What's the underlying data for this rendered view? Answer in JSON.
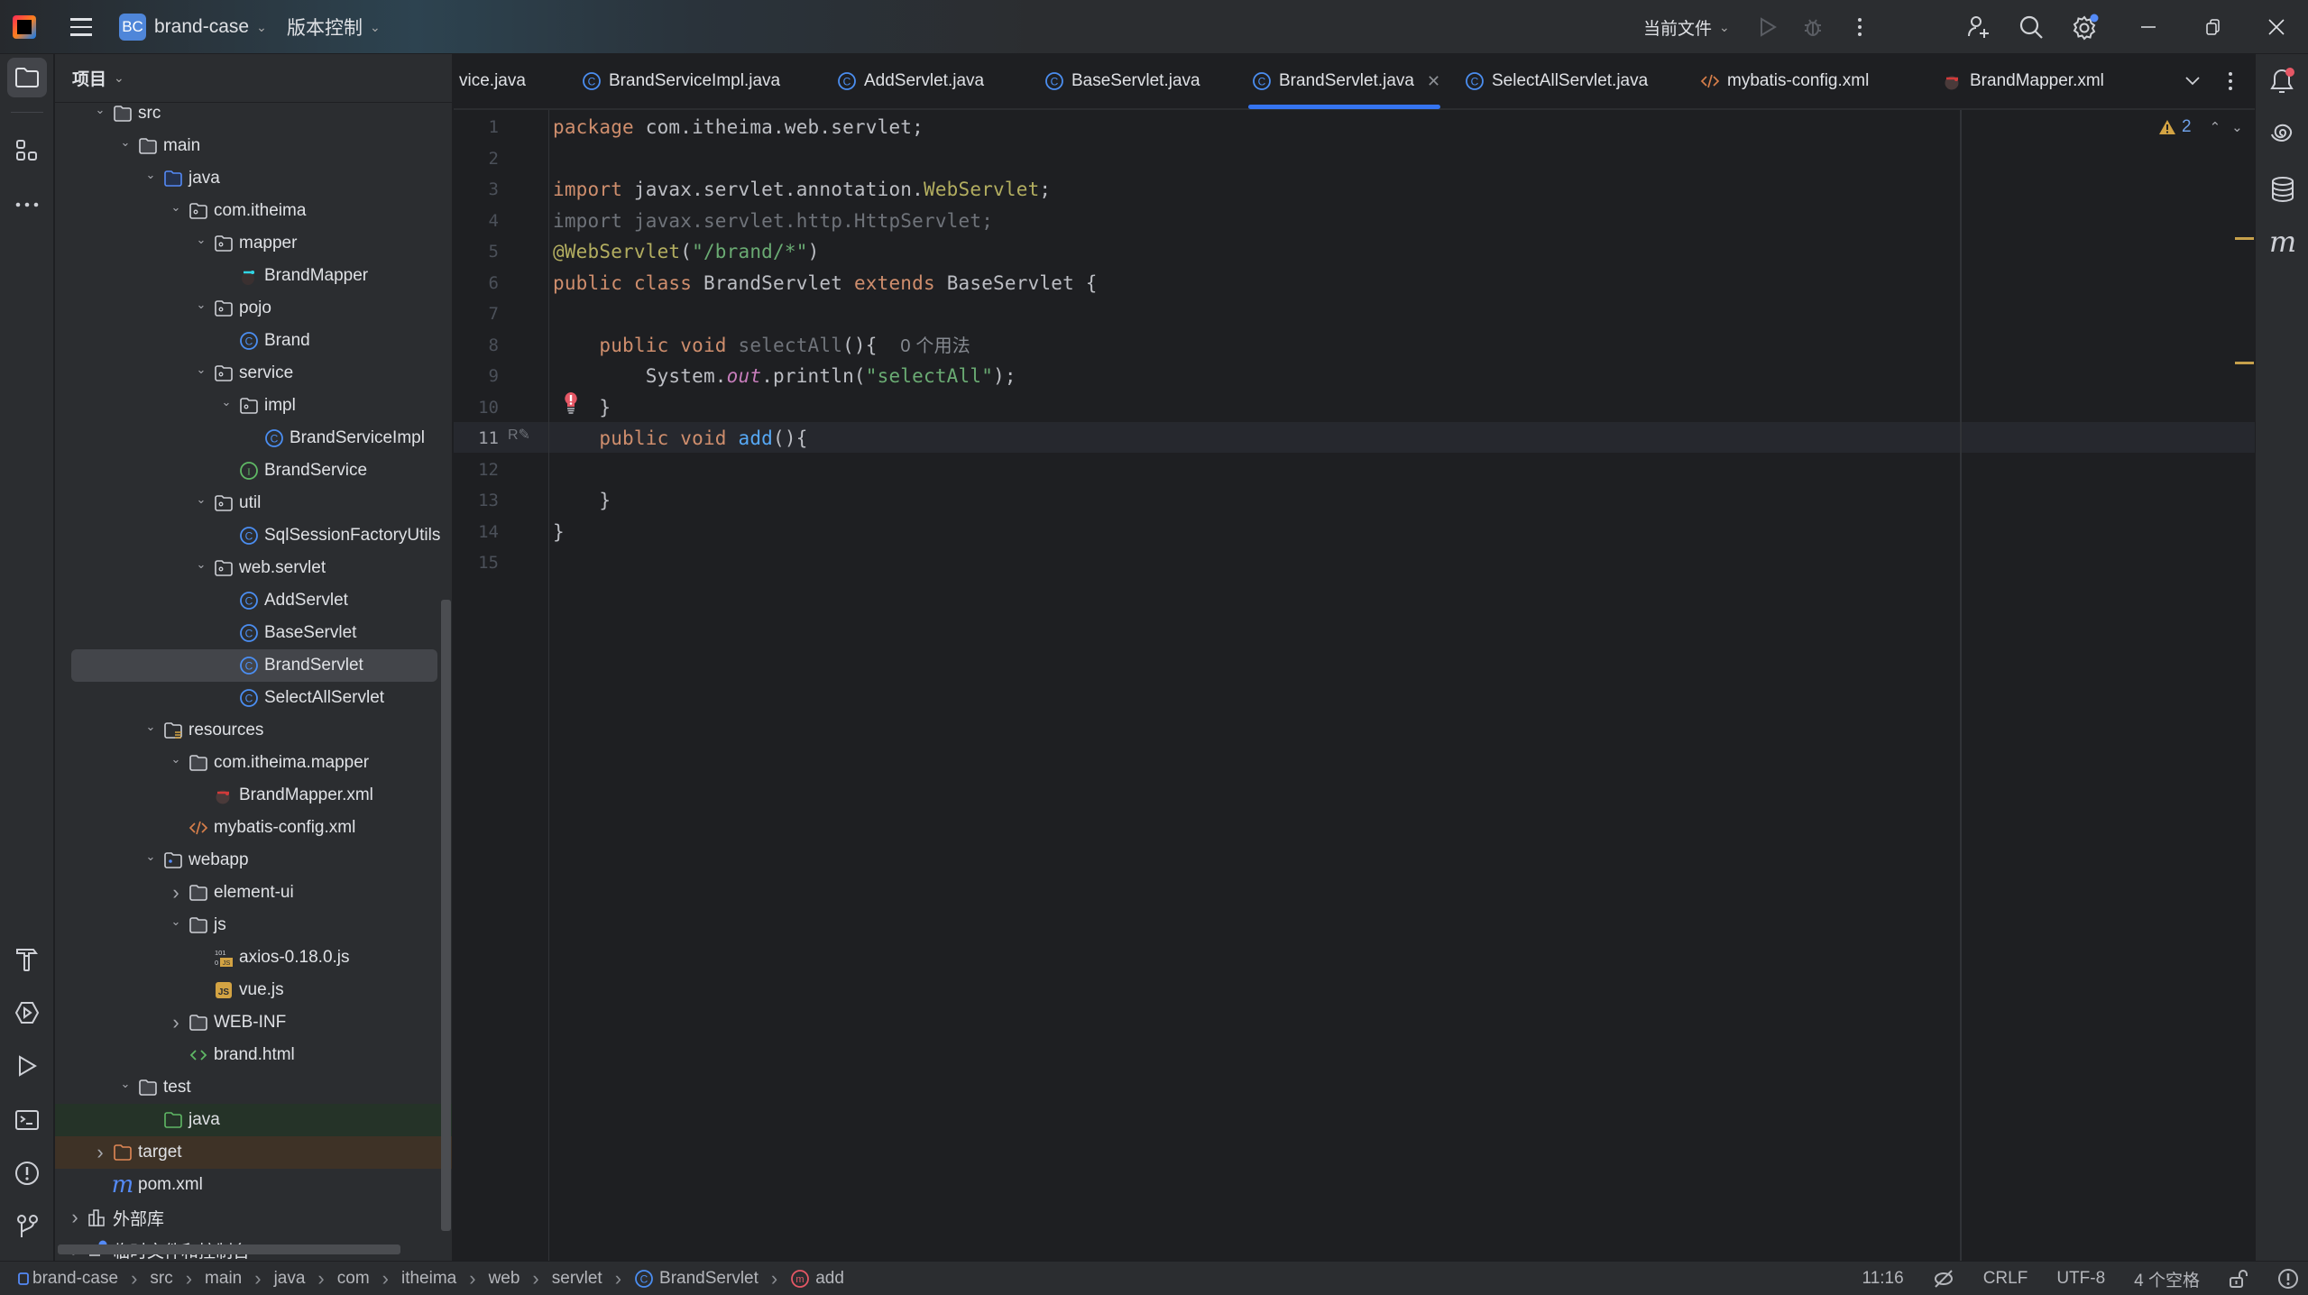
{
  "titlebar": {
    "project_badge": "BC",
    "project_name": "brand-case",
    "vcs_label": "版本控制",
    "run_config": "当前文件"
  },
  "project_panel": {
    "title": "项目",
    "tree": [
      {
        "label": "src",
        "depth": 2,
        "expanded": true,
        "icon": "folder-icon"
      },
      {
        "label": "main",
        "depth": 3,
        "expanded": true,
        "icon": "folder-icon"
      },
      {
        "label": "java",
        "depth": 4,
        "expanded": true,
        "icon": "source-folder-icon"
      },
      {
        "label": "com.itheima",
        "depth": 5,
        "expanded": true,
        "icon": "package-icon"
      },
      {
        "label": "mapper",
        "depth": 6,
        "expanded": true,
        "icon": "package-icon"
      },
      {
        "label": "BrandMapper",
        "depth": 7,
        "icon": "mybatis-mapper-icon"
      },
      {
        "label": "pojo",
        "depth": 6,
        "expanded": true,
        "icon": "package-icon"
      },
      {
        "label": "Brand",
        "depth": 7,
        "icon": "class-icon"
      },
      {
        "label": "service",
        "depth": 6,
        "expanded": true,
        "icon": "package-icon"
      },
      {
        "label": "impl",
        "depth": 7,
        "expanded": true,
        "icon": "package-icon"
      },
      {
        "label": "BrandServiceImpl",
        "depth": 8,
        "icon": "class-icon"
      },
      {
        "label": "BrandService",
        "depth": 7,
        "icon": "interface-icon"
      },
      {
        "label": "util",
        "depth": 6,
        "expanded": true,
        "icon": "package-icon"
      },
      {
        "label": "SqlSessionFactoryUtils",
        "depth": 7,
        "icon": "class-icon"
      },
      {
        "label": "web.servlet",
        "depth": 6,
        "expanded": true,
        "icon": "package-icon"
      },
      {
        "label": "AddServlet",
        "depth": 7,
        "icon": "class-icon"
      },
      {
        "label": "BaseServlet",
        "depth": 7,
        "icon": "class-icon"
      },
      {
        "label": "BrandServlet",
        "depth": 7,
        "icon": "class-icon",
        "selected": true
      },
      {
        "label": "SelectAllServlet",
        "depth": 7,
        "icon": "class-icon"
      },
      {
        "label": "resources",
        "depth": 4,
        "expanded": true,
        "icon": "resources-folder-icon"
      },
      {
        "label": "com.itheima.mapper",
        "depth": 5,
        "expanded": true,
        "icon": "folder-icon"
      },
      {
        "label": "BrandMapper.xml",
        "depth": 6,
        "icon": "mybatis-xml-icon"
      },
      {
        "label": "mybatis-config.xml",
        "depth": 5,
        "icon": "xml-icon"
      },
      {
        "label": "webapp",
        "depth": 4,
        "expanded": true,
        "icon": "web-folder-icon"
      },
      {
        "label": "element-ui",
        "depth": 5,
        "expanded": false,
        "icon": "folder-icon"
      },
      {
        "label": "js",
        "depth": 5,
        "expanded": true,
        "icon": "folder-icon"
      },
      {
        "label": "axios-0.18.0.js",
        "depth": 6,
        "icon": "minified-js-icon"
      },
      {
        "label": "vue.js",
        "depth": 6,
        "icon": "js-icon"
      },
      {
        "label": "WEB-INF",
        "depth": 5,
        "expanded": false,
        "icon": "folder-icon"
      },
      {
        "label": "brand.html",
        "depth": 5,
        "icon": "html-icon"
      },
      {
        "label": "test",
        "depth": 3,
        "expanded": true,
        "icon": "folder-icon"
      },
      {
        "label": "java",
        "depth": 4,
        "icon": "test-folder-icon",
        "highlight": "test"
      },
      {
        "label": "target",
        "depth": 2,
        "expanded": false,
        "icon": "excluded-folder-icon",
        "highlight": "excluded"
      },
      {
        "label": "pom.xml",
        "depth": 2,
        "icon": "maven-icon"
      },
      {
        "label": "外部库",
        "depth": 1,
        "expanded": false,
        "icon": "library-icon"
      },
      {
        "label": "临时文件和控制台",
        "depth": 1,
        "expanded": false,
        "icon": "scratches-icon"
      }
    ]
  },
  "tabs": [
    {
      "label": "vice.java",
      "icon": "none"
    },
    {
      "label": "BrandServiceImpl.java",
      "icon": "class-icon"
    },
    {
      "label": "AddServlet.java",
      "icon": "class-icon"
    },
    {
      "label": "BaseServlet.java",
      "icon": "class-icon"
    },
    {
      "label": "BrandServlet.java",
      "icon": "class-icon",
      "active": true
    },
    {
      "label": "SelectAllServlet.java",
      "icon": "class-icon"
    },
    {
      "label": "mybatis-config.xml",
      "icon": "xml-icon"
    },
    {
      "label": "BrandMapper.xml",
      "icon": "mybatis-xml-icon"
    }
  ],
  "editor": {
    "warning_count": "2",
    "current_line": 11,
    "lines": [
      {
        "n": "1",
        "code": [
          [
            "kw",
            "package "
          ],
          [
            "",
            "com.itheima.web.servlet;"
          ]
        ]
      },
      {
        "n": "2",
        "code": []
      },
      {
        "n": "3",
        "code": [
          [
            "kw",
            "import "
          ],
          [
            "",
            "javax.servlet.annotation."
          ],
          [
            "ann",
            "WebServlet"
          ],
          [
            "",
            ";"
          ]
        ]
      },
      {
        "n": "4",
        "code": [
          [
            "unused",
            "import javax.servlet.http.HttpServlet;"
          ]
        ]
      },
      {
        "n": "5",
        "code": [
          [
            "ann",
            "@WebServlet"
          ],
          [
            "",
            "("
          ],
          [
            "str",
            "\"/brand/*\""
          ],
          [
            "",
            ")"
          ]
        ]
      },
      {
        "n": "6",
        "code": [
          [
            "kw",
            "public class "
          ],
          [
            "",
            "BrandServlet "
          ],
          [
            "kw",
            "extends "
          ],
          [
            "",
            "BaseServlet {"
          ]
        ]
      },
      {
        "n": "7",
        "code": []
      },
      {
        "n": "8",
        "code": [
          [
            "",
            "    "
          ],
          [
            "kw",
            "public void "
          ],
          [
            "unused",
            "selectAll"
          ],
          [
            "",
            "(){  "
          ],
          [
            "hint",
            "0 个用法"
          ]
        ]
      },
      {
        "n": "9",
        "code": [
          [
            "",
            "        System."
          ],
          [
            "static",
            "out"
          ],
          [
            "",
            ".println("
          ],
          [
            "str",
            "\"selectAll\""
          ],
          [
            "",
            ");"
          ]
        ]
      },
      {
        "n": "10",
        "code": [
          [
            "",
            "    }"
          ]
        ]
      },
      {
        "n": "11",
        "code": [
          [
            "",
            "    "
          ],
          [
            "kw",
            "public void "
          ],
          [
            "fn",
            "add"
          ],
          [
            "",
            "(){"
          ]
        ]
      },
      {
        "n": "12",
        "code": []
      },
      {
        "n": "13",
        "code": [
          [
            "",
            "    }"
          ]
        ]
      },
      {
        "n": "14",
        "code": [
          [
            "",
            "}"
          ]
        ]
      },
      {
        "n": "15",
        "code": []
      }
    ]
  },
  "statusbar": {
    "breadcrumbs": [
      "brand-case",
      "src",
      "main",
      "java",
      "com",
      "itheima",
      "web",
      "servlet",
      "BrandServlet",
      "add"
    ],
    "caret_position": "11:16",
    "line_separator": "CRLF",
    "encoding": "UTF-8",
    "indent": "4 个空格"
  },
  "colors": {
    "accent": "#3574f0",
    "class_icon": "#4b8ef1",
    "interface_icon": "#5fb865",
    "warning": "#d3a343",
    "error_bulb": "#e55765"
  }
}
